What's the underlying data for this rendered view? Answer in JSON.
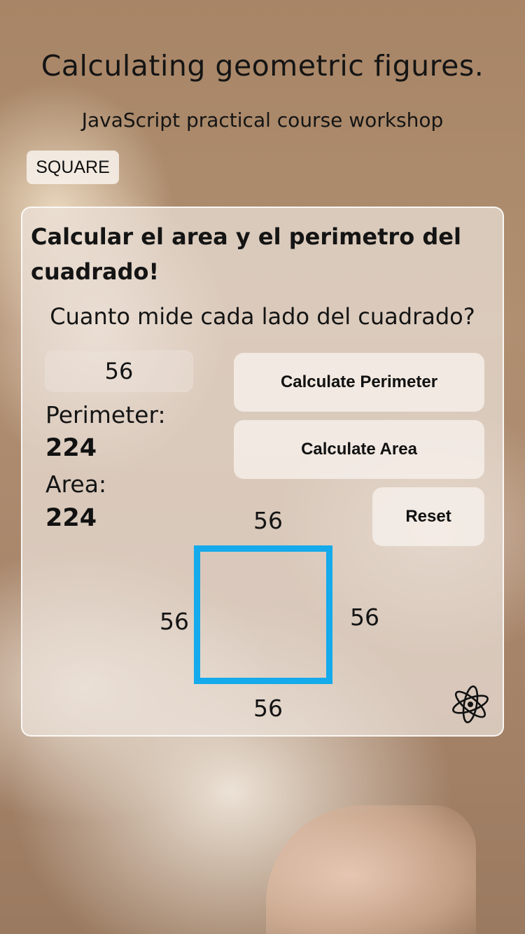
{
  "header": {
    "title": "Calculating geometric figures.",
    "subtitle": "JavaScript practical course workshop"
  },
  "tabs": {
    "square_label": "SQUARE"
  },
  "card": {
    "heading": "Calcular el area y el perimetro del cuadrado!",
    "question": "Cuanto mide cada lado del cuadrado?",
    "side_input_value": "56",
    "buttons": {
      "perimeter": "Calculate Perimeter",
      "area": "Calculate Area",
      "reset": "Reset"
    },
    "results": {
      "perimeter_label": "Perimeter:",
      "perimeter_value": "224",
      "area_label": "Area:",
      "area_value": "224"
    },
    "figure": {
      "top": "56",
      "left": "56",
      "right": "56",
      "bottom": "56",
      "stroke_color": "#14aaeb"
    },
    "logo_icon": "atom-logo-icon"
  }
}
